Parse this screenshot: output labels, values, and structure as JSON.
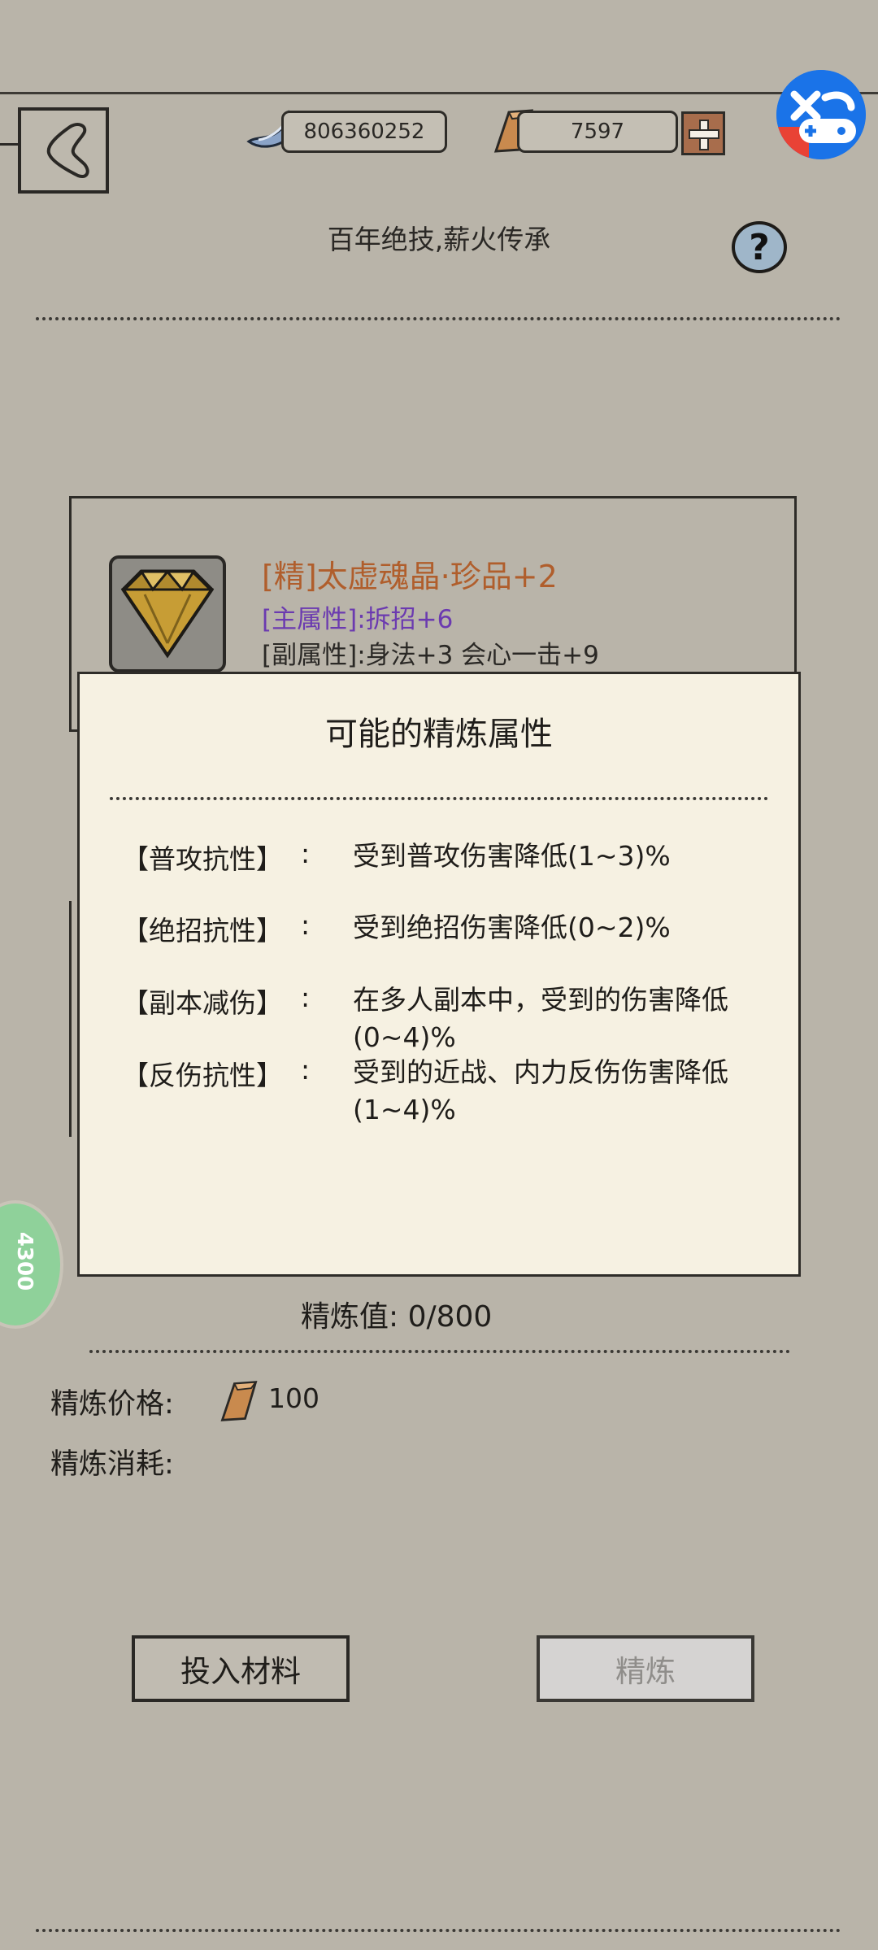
{
  "header": {
    "silver_amount": "806360252",
    "gold_amount": "7597",
    "subtitle": "百年绝技,薪火传承"
  },
  "item": {
    "name": "[精]太虚魂晶·珍品+2",
    "main_attr": "[主属性]:拆招+6",
    "sub_attr": "[副属性]:身法+3 会心一击+9"
  },
  "popup": {
    "title": "可能的精炼属性",
    "attributes": [
      {
        "name": "【普攻抗性】",
        "colon": ":",
        "desc": "受到普攻伤害降低(1~3)%"
      },
      {
        "name": "【绝招抗性】",
        "colon": ":",
        "desc": "受到绝招伤害降低(0~2)%"
      },
      {
        "name": "【副本减伤】",
        "colon": ":",
        "desc": "在多人副本中，受到的伤害降低(0~4)%"
      },
      {
        "name": "【反伤抗性】",
        "colon": ":",
        "desc": "受到的近战、内力反伤伤害降低(1~4)%"
      }
    ]
  },
  "refine": {
    "value_text": "精炼值:  0/800",
    "price_label": "精炼价格:",
    "price_value": "100",
    "cost_label": "精炼消耗:"
  },
  "buttons": {
    "input_material": "投入材料",
    "refine": "精炼"
  },
  "side_badge": "4300",
  "colors": {
    "background": "#b9b4a9",
    "popup_bg": "#f6f1e2",
    "item_name": "#b05e2c",
    "main_attr": "#6b3ab0",
    "refine_disabled": "#d5d3d2"
  }
}
